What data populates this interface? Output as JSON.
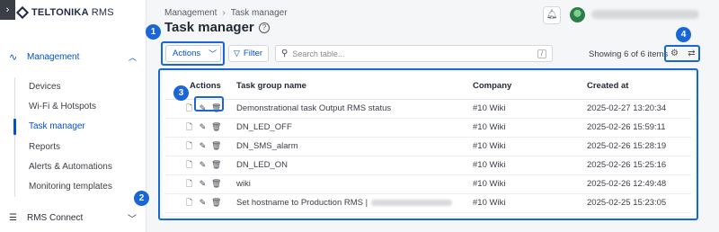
{
  "brand": {
    "name": "TELTONIKA",
    "product": "RMS"
  },
  "sidebar": {
    "section": {
      "label": "Management",
      "icon": "activity-icon"
    },
    "items": [
      {
        "label": "Devices"
      },
      {
        "label": "Wi-Fi & Hotspots"
      },
      {
        "label": "Task manager"
      },
      {
        "label": "Reports"
      },
      {
        "label": "Alerts & Automations"
      },
      {
        "label": "Monitoring templates"
      }
    ],
    "bottom": {
      "label": "RMS Connect"
    }
  },
  "header": {
    "breadcrumb": [
      "Management",
      "Task manager"
    ],
    "title": "Task manager"
  },
  "toolbar": {
    "actions_label": "Actions",
    "filter_label": "Filter",
    "search_placeholder": "Search table...",
    "search_shortcut": "/",
    "showing": "Showing 6 of 6 items"
  },
  "table": {
    "columns": [
      "Actions",
      "Task group name",
      "Company",
      "Created at"
    ],
    "rows": [
      {
        "name": "Demonstrational task Output RMS status",
        "company": "#10 Wiki",
        "created": "2025-02-27 13:20:34"
      },
      {
        "name": "DN_LED_OFF",
        "company": "#10 Wiki",
        "created": "2025-02-26 15:59:11"
      },
      {
        "name": "DN_SMS_alarm",
        "company": "#10 Wiki",
        "created": "2025-02-26 15:28:19"
      },
      {
        "name": "DN_LED_ON",
        "company": "#10 Wiki",
        "created": "2025-02-26 15:25:16"
      },
      {
        "name": "wiki",
        "company": "#10 Wiki",
        "created": "2025-02-26 12:49:48"
      },
      {
        "name": "Set hostname to Production RMS |",
        "company": "#10 Wiki",
        "created": "2025-02-25 15:23:05"
      }
    ]
  },
  "callouts": [
    "1",
    "2",
    "3",
    "4"
  ],
  "colors": {
    "accent": "#0052cc",
    "callout": "#1a66d6"
  }
}
